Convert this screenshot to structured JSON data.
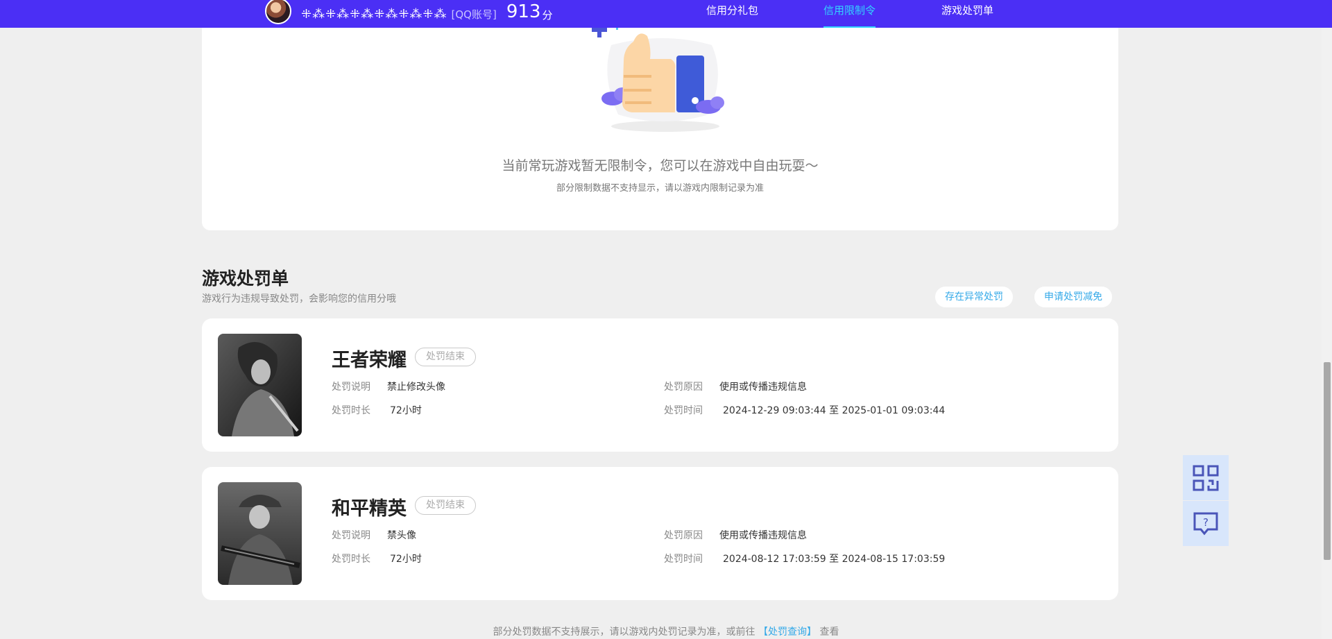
{
  "header": {
    "nickname": "⁜⁂⁜⁂⁜⁂⁜⁂⁜⁂⁜⁂",
    "account_type": "[QQ账号]",
    "score": "913",
    "score_unit": "分",
    "nav": [
      {
        "label": "信用分礼包"
      },
      {
        "label": "信用限制令"
      },
      {
        "label": "游戏处罚单"
      }
    ],
    "accent_color": "#4b2ff5",
    "active_color": "#32d4ff"
  },
  "restriction": {
    "empty_title": "当前常玩游戏暂无限制令，您可以在游戏中自由玩耍～",
    "empty_note": "部分限制数据不支持显示，请以游戏内限制记录为准"
  },
  "penalty_section": {
    "title": "游戏处罚单",
    "subtitle": "游戏行为违规导致处罚，会影响您的信用分哦",
    "actions": [
      {
        "label": "存在异常处罚"
      },
      {
        "label": "申请处罚减免"
      }
    ],
    "labels": {
      "description": "处罚说明",
      "duration": "处罚时长",
      "reason": "处罚原因",
      "time": "处罚时间"
    },
    "items": [
      {
        "game": "王者荣耀",
        "status": "处罚结束",
        "description": "禁止修改头像",
        "duration": "72小时",
        "reason": "使用或传播违规信息",
        "time": "2024-12-29 09:03:44 至 2025-01-01 09:03:44"
      },
      {
        "game": "和平精英",
        "status": "处罚结束",
        "description": "禁头像",
        "duration": "72小时",
        "reason": "使用或传播违规信息",
        "time": "2024-08-12 17:03:59 至 2024-08-15 17:03:59"
      }
    ]
  },
  "footer": {
    "text_before": "部分处罚数据不支持展示，请以游戏内处罚记录为准，或前往",
    "link": "【处罚查询】",
    "text_after": "查看"
  },
  "side_buttons": {
    "qr": "qr-code-icon",
    "help": "help-chat-icon"
  }
}
